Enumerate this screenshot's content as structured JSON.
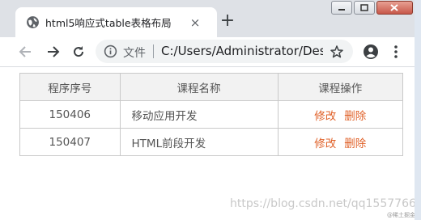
{
  "browser": {
    "tab_title": "html5响应式table表格布局",
    "new_tab": "+",
    "close_tab": "×",
    "omnibox": {
      "security_label": "文件",
      "url": "C:/Users/Administrator/Des..."
    }
  },
  "table": {
    "headers": [
      "程序序号",
      "课程名称",
      "课程操作"
    ],
    "rows": [
      {
        "id": "150406",
        "name": "移动应用开发",
        "edit": "修改",
        "delete": "删除"
      },
      {
        "id": "150407",
        "name": "HTML前段开发",
        "edit": "修改",
        "delete": "删除"
      }
    ]
  },
  "watermark": {
    "url": "https://blog.csdn.net/qq1557766",
    "small": "@稀土掘金技术社区"
  },
  "colors": {
    "tabstrip": "#dee1e6",
    "action_link": "#e0622a",
    "header_bg": "#f2f2f2",
    "border": "#c9c9c9"
  }
}
